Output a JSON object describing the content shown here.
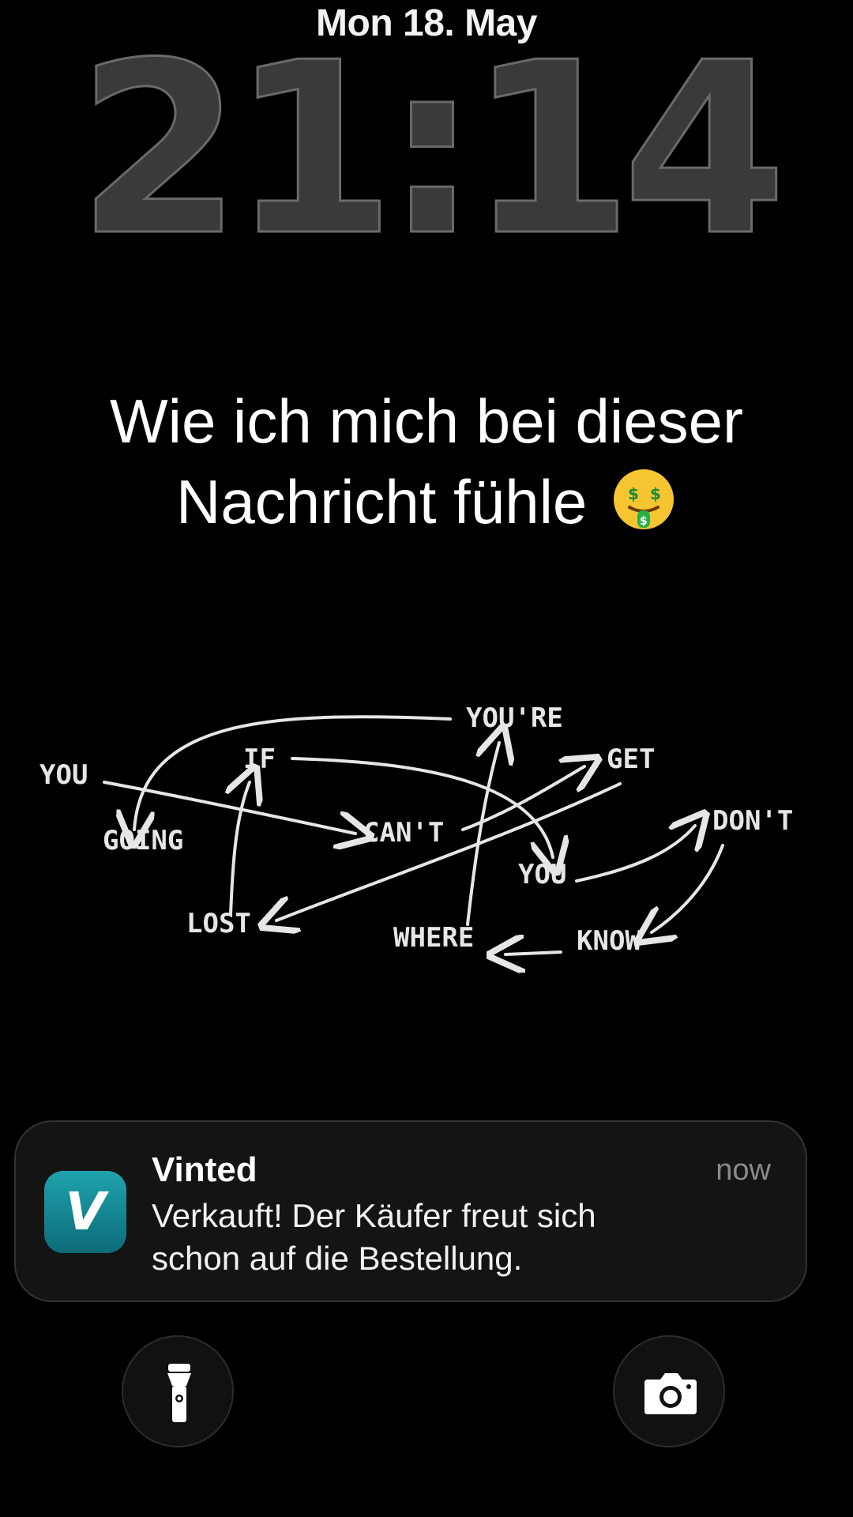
{
  "lockscreen": {
    "date": "Mon 18. May",
    "time": "21:14"
  },
  "caption": {
    "line1": "Wie ich mich bei dieser",
    "line2": "Nachricht fühle",
    "emoji_icon": "money-mouth-face-icon"
  },
  "doodle": {
    "words": [
      "YOU",
      "IF",
      "YOU'RE",
      "GET",
      "DON'T",
      "GOING",
      "CAN'T",
      "YOU",
      "LOST",
      "WHERE",
      "KNOW"
    ]
  },
  "notification": {
    "app": "Vinted",
    "time": "now",
    "line1": "Verkauft! Der Käufer freut sich",
    "line2": "schon auf die Bestellung.",
    "icon_letter": "V",
    "icon_color": "#137f8b"
  },
  "quick_actions": {
    "left_icon": "flashlight-icon",
    "right_icon": "camera-icon"
  }
}
